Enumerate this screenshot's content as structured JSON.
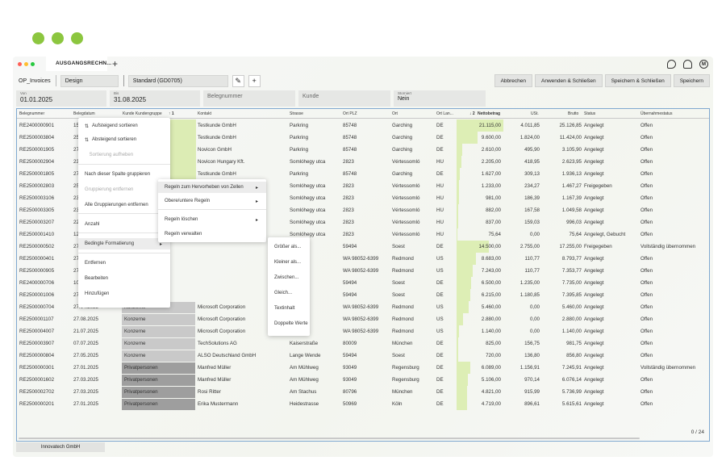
{
  "window": {
    "tab_label": "AUSGANGSRECHN...",
    "new_tab": "+",
    "icons": [
      "chat-icon",
      "bell-icon",
      "user-icon"
    ],
    "user_initial": "M"
  },
  "toolbar": {
    "label": "OP_Invoices",
    "design_select": "Design",
    "standard_select": "Standard (GD0705)",
    "edit_icon": "✎",
    "add_icon": "+",
    "cancel": "Abbrechen",
    "apply_close": "Anwenden & Schließen",
    "save_close": "Speichern & Schließen",
    "save": "Speichern"
  },
  "filters": {
    "from_label": "Von",
    "from_value": "01.01.2025",
    "to_label": "Bis",
    "to_value": "31.08.2025",
    "doc_placeholder": "Belegnummer",
    "customer_placeholder": "Kunde",
    "storno_label": "Storniert",
    "storno_value": "Nein"
  },
  "columns": {
    "doc": "Belegnummer",
    "date": "Belegdatum",
    "group": "Kunde Kundengruppe",
    "sort": "↑ 1",
    "contact": "Kontakt",
    "street": "Strasse",
    "zip": "Ort PLZ",
    "city": "Ort",
    "country": "Ort Lan...",
    "net_sort": "↓ 2",
    "net": "Nettobetrag",
    "vat": "USt.",
    "gross": "Brutto",
    "status": "Status",
    "transfer": "Übernahmestatus"
  },
  "rows": [
    {
      "doc": "RE2400000901",
      "date": "15",
      "group": "stand",
      "contact": "Testkunde GmbH",
      "street": "Parkring",
      "zip": "85748",
      "city": "Garching",
      "country": "DE",
      "net": "21.115,00",
      "vat": "4.011,85",
      "gross": "25.126,85",
      "status": "Angelegt",
      "transfer": "Offen",
      "bar": 1.0
    },
    {
      "doc": "RE2500003804",
      "date": "25",
      "group": "stand",
      "contact": "Testkunde GmbH",
      "street": "Parkring",
      "zip": "85748",
      "city": "Garching",
      "country": "DE",
      "net": "9.600,00",
      "vat": "1.824,00",
      "gross": "11.424,00",
      "status": "Angelegt",
      "transfer": "Offen",
      "bar": 0.455
    },
    {
      "doc": "RE2500001905",
      "date": "27",
      "group": "stand",
      "contact": "Novicon GmbH",
      "street": "Parkring",
      "zip": "85748",
      "city": "Garching",
      "country": "DE",
      "net": "2.610,00",
      "vat": "495,90",
      "gross": "3.105,90",
      "status": "Angelegt",
      "transfer": "Offen",
      "bar": 0.124
    },
    {
      "doc": "RE2500002904",
      "date": "23",
      "group": "stand",
      "contact": "Novicon Hungary Kft.",
      "street": "Somlóhegy utca",
      "zip": "2823",
      "city": "Vértessomló",
      "country": "HU",
      "net": "2.205,00",
      "vat": "418,95",
      "gross": "2.623,95",
      "status": "Angelegt",
      "transfer": "Offen",
      "bar": 0.104
    },
    {
      "doc": "RE2500001805",
      "date": "27",
      "group": "stand",
      "contact": "Testkunde GmbH",
      "street": "Parkring",
      "zip": "85748",
      "city": "Garching",
      "country": "DE",
      "net": "1.627,00",
      "vat": "309,13",
      "gross": "1.936,13",
      "status": "Angelegt",
      "transfer": "Offen",
      "bar": 0.077
    },
    {
      "doc": "RE2500002803",
      "date": "25",
      "group": "stand",
      "contact": "Novicon Hungary Kft.",
      "street": "Somlóhegy utca",
      "zip": "2823",
      "city": "Vértessomló",
      "country": "HU",
      "net": "1.233,00",
      "vat": "234,27",
      "gross": "1.467,27",
      "status": "Freigegeben",
      "transfer": "Offen",
      "bar": 0.058
    },
    {
      "doc": "RE2500003106",
      "date": "23",
      "group": "stand",
      "contact": "Novicon Hungary Kft.",
      "street": "Somlóhegy utca",
      "zip": "2823",
      "city": "Vértessomló",
      "country": "HU",
      "net": "981,00",
      "vat": "186,39",
      "gross": "1.167,39",
      "status": "Angelegt",
      "transfer": "Offen",
      "bar": 0.046
    },
    {
      "doc": "RE2500003305",
      "date": "23",
      "group": "stand",
      "contact": "Novicon Hungary Kft.",
      "street": "Somlóhegy utca",
      "zip": "2823",
      "city": "Vértessomló",
      "country": "HU",
      "net": "882,00",
      "vat": "167,58",
      "gross": "1.049,58",
      "status": "Angelegt",
      "transfer": "Offen",
      "bar": 0.042
    },
    {
      "doc": "RE2500003207",
      "date": "22",
      "group": "stand",
      "contact": "Novicon Hungary Kft.",
      "street": "Somlóhegy utca",
      "zip": "2823",
      "city": "Vértessomló",
      "country": "HU",
      "net": "837,00",
      "vat": "159,03",
      "gross": "996,03",
      "status": "Angelegt",
      "transfer": "Offen",
      "bar": 0.04
    },
    {
      "doc": "RE2500001410",
      "date": "12",
      "group": "stand",
      "contact": "Novicon Hungary Kft.",
      "street": "Somlóhegy utca",
      "zip": "2823",
      "city": "Vértessomló",
      "country": "HU",
      "net": "75,64",
      "vat": "0,00",
      "gross": "75,64",
      "status": "Angelegt, Gebucht",
      "transfer": "Offen",
      "bar": 0.004
    },
    {
      "doc": "RE2500000502",
      "date": "27",
      "group": "",
      "contact": "",
      "street": "de",
      "zip": "59494",
      "city": "Soest",
      "country": "DE",
      "net": "14.500,00",
      "vat": "2.755,00",
      "gross": "17.255,00",
      "status": "Freigegeben",
      "transfer": "Vollständig übernommen",
      "bar": 0.687
    },
    {
      "doc": "RE2500000401",
      "date": "27",
      "group": "",
      "contact": "",
      "street": "oft Way",
      "zip": "WA 98052-6399",
      "city": "Redmond",
      "country": "US",
      "net": "8.683,00",
      "vat": "110,77",
      "gross": "8.793,77",
      "status": "Angelegt",
      "transfer": "Offen",
      "bar": 0.41
    },
    {
      "doc": "RE2500000905",
      "date": "27",
      "group": "",
      "contact": "",
      "street": "oft Way",
      "zip": "WA 98052-6399",
      "city": "Redmond",
      "country": "US",
      "net": "7.243,00",
      "vat": "110,77",
      "gross": "7.353,77",
      "status": "Angelegt",
      "transfer": "Offen",
      "bar": 0.343
    },
    {
      "doc": "RE2400000706",
      "date": "10",
      "group": "",
      "contact": "",
      "street": "de",
      "zip": "59494",
      "city": "Soest",
      "country": "DE",
      "net": "6.500,00",
      "vat": "1.235,00",
      "gross": "7.735,00",
      "status": "Angelegt",
      "transfer": "Offen",
      "bar": 0.308
    },
    {
      "doc": "RE2500001006",
      "date": "27",
      "group": "",
      "contact": "",
      "street": "de",
      "zip": "59494",
      "city": "Soest",
      "country": "DE",
      "net": "6.215,00",
      "vat": "1.180,85",
      "gross": "7.395,85",
      "status": "Angelegt",
      "transfer": "Offen",
      "bar": 0.294
    },
    {
      "doc": "RE2500000704",
      "date": "27.04.2025",
      "group": "Konzerne",
      "contact": "Microsoft Corporation",
      "street": "oft Way",
      "zip": "WA 98052-6399",
      "city": "Redmond",
      "country": "US",
      "net": "5.460,00",
      "vat": "0,00",
      "gross": "5.460,00",
      "status": "Angelegt",
      "transfer": "Offen",
      "bar": 0.259
    },
    {
      "doc": "RE2500001107",
      "date": "27.08.2025",
      "group": "Konzerne",
      "contact": "Microsoft Corporation",
      "street": "oft Way",
      "zip": "WA 98052-6399",
      "city": "Redmond",
      "country": "US",
      "net": "2.880,00",
      "vat": "0,00",
      "gross": "2.880,00",
      "status": "Angelegt",
      "transfer": "Offen",
      "bar": 0.136
    },
    {
      "doc": "RE2500004007",
      "date": "21.07.2025",
      "group": "Konzerne",
      "contact": "Microsoft Corporation",
      "street": "oft Way",
      "zip": "WA 98052-6399",
      "city": "Redmond",
      "country": "US",
      "net": "1.140,00",
      "vat": "0,00",
      "gross": "1.140,00",
      "status": "Angelegt",
      "transfer": "Offen",
      "bar": 0.054
    },
    {
      "doc": "RE2500003907",
      "date": "07.07.2025",
      "group": "Konzerne",
      "contact": "TechSolutions AG",
      "street": "Kaiserstraße",
      "zip": "80009",
      "city": "München",
      "country": "DE",
      "net": "825,00",
      "vat": "156,75",
      "gross": "981,75",
      "status": "Angelegt",
      "transfer": "Offen",
      "bar": 0.039
    },
    {
      "doc": "RE2500000804",
      "date": "27.05.2025",
      "group": "Konzerne",
      "contact": "ALSO Deutschland GmbH",
      "street": "Lange Wende",
      "zip": "59494",
      "city": "Soest",
      "country": "DE",
      "net": "720,00",
      "vat": "136,80",
      "gross": "856,80",
      "status": "Angelegt",
      "transfer": "Offen",
      "bar": 0.034
    },
    {
      "doc": "RE2500000301",
      "date": "27.01.2025",
      "group": "Privatpersonen",
      "contact": "Manfred Müller",
      "street": "Am Mühlweg",
      "zip": "93049",
      "city": "Regensburg",
      "country": "DE",
      "net": "6.089,00",
      "vat": "1.156,91",
      "gross": "7.245,91",
      "status": "Angelegt",
      "transfer": "Vollständig übernommen",
      "bar": 0.288
    },
    {
      "doc": "RE2500001602",
      "date": "27.03.2025",
      "group": "Privatpersonen",
      "contact": "Manfred Müller",
      "street": "Am Mühlweg",
      "zip": "93049",
      "city": "Regensburg",
      "country": "DE",
      "net": "5.106,00",
      "vat": "970,14",
      "gross": "6.076,14",
      "status": "Angelegt",
      "transfer": "Offen",
      "bar": 0.242
    },
    {
      "doc": "RE2500002702",
      "date": "27.03.2025",
      "group": "Privatpersonen",
      "contact": "Rosi Ritter",
      "street": "Am Stachus",
      "zip": "80796",
      "city": "München",
      "country": "DE",
      "net": "4.821,00",
      "vat": "915,99",
      "gross": "5.736,99",
      "status": "Angelegt",
      "transfer": "Offen",
      "bar": 0.228
    },
    {
      "doc": "RE2500000201",
      "date": "27.01.2025",
      "group": "Privatpersonen",
      "contact": "Erika Mustermann",
      "street": "Heidestrasse",
      "zip": "50969",
      "city": "Köln",
      "country": "DE",
      "net": "4.719,00",
      "vat": "896,61",
      "gross": "5.615,61",
      "status": "Angelegt",
      "transfer": "Offen",
      "bar": 0.223
    }
  ],
  "context_menu": {
    "sort_asc": "Aufsteigend sortieren",
    "sort_desc": "Absteigend sortieren",
    "sort_clear": "Sortierung aufheben",
    "group_by": "Nach dieser Spalte gruppieren",
    "ungroup": "Gruppierung entfernen",
    "ungroup_all": "Alle Gruppierungen entfernen",
    "count": "Anzahl",
    "cond_format": "Bedingte Formatierung",
    "remove": "Entfernen",
    "edit": "Bearbeiten",
    "add": "Hinzufügen"
  },
  "submenu": {
    "highlight": "Regeln zum Hervorheben von Zellen",
    "topbottom": "Obere/untere Regeln",
    "clear": "Regeln löschen",
    "manage": "Regeln verwalten"
  },
  "submenu2": {
    "greater": "Größer als...",
    "less": "Kleiner als...",
    "between": "Zwischen...",
    "equal": "Gleich...",
    "text": "Textinhalt",
    "duplicates": "Doppelte Werte"
  },
  "footer": {
    "counter": "0 / 24",
    "company_tab": "Innovatech GmbH"
  },
  "colors": {
    "accent_green": "#8cc63f",
    "highlight_green": "#dcecb4",
    "highlight_gray": "#c9c9c9",
    "highlight_dark": "#9e9e9e",
    "grid_border": "#7fa8d0"
  }
}
